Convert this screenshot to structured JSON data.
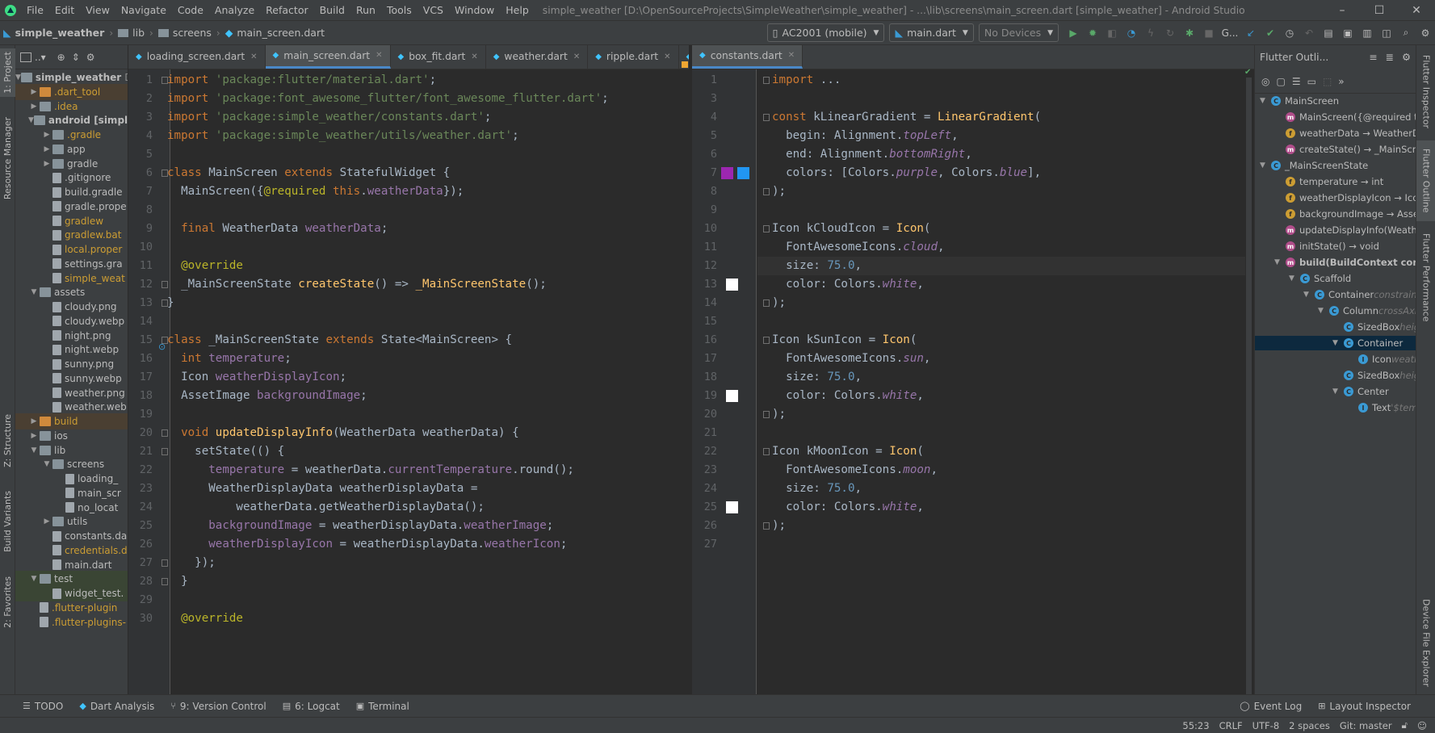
{
  "titlebar": {
    "menu": [
      "File",
      "Edit",
      "View",
      "Navigate",
      "Code",
      "Analyze",
      "Refactor",
      "Build",
      "Run",
      "Tools",
      "VCS",
      "Window",
      "Help"
    ],
    "window_title": "simple_weather [D:\\OpenSourceProjects\\SimpleWeather\\simple_weather] - ...\\lib\\screens\\main_screen.dart [simple_weather] - Android Studio"
  },
  "navbar": {
    "crumbs": [
      "simple_weather",
      "lib",
      "screens",
      "main_screen.dart"
    ],
    "device": "AC2001 (mobile)",
    "run_config": "main.dart",
    "devices2": "No Devices",
    "git_label": "G..."
  },
  "left_toolwindows": [
    "1: Project",
    "Resource Manager",
    "Z: Structure",
    "Build Variants",
    "2: Favorites"
  ],
  "right_toolwindows": [
    "Flutter Inspector",
    "Flutter Outline",
    "Flutter Performance",
    "Device File Explorer"
  ],
  "project": {
    "header_icon": "▪..▾",
    "root": "simple_weather",
    "root_suffix": "D:",
    "items": [
      {
        "label": ".dart_tool",
        "indent": 1,
        "arrow": "▶",
        "type": "folder",
        "color": "yellow",
        "bg": "orange"
      },
      {
        "label": ".idea",
        "indent": 1,
        "arrow": "▶",
        "type": "folder",
        "color": "yellow"
      },
      {
        "label": "android [simple",
        "indent": 1,
        "arrow": "▼",
        "type": "folder",
        "bold": true
      },
      {
        "label": ".gradle",
        "indent": 2,
        "arrow": "▶",
        "type": "folder",
        "color": "yellow"
      },
      {
        "label": "app",
        "indent": 2,
        "arrow": "▶",
        "type": "folder"
      },
      {
        "label": "gradle",
        "indent": 2,
        "arrow": "▶",
        "type": "folder"
      },
      {
        "label": ".gitignore",
        "indent": 2,
        "type": "file"
      },
      {
        "label": "build.gradle",
        "indent": 2,
        "type": "file"
      },
      {
        "label": "gradle.prope",
        "indent": 2,
        "type": "file"
      },
      {
        "label": "gradlew",
        "indent": 2,
        "type": "file",
        "color": "yellow"
      },
      {
        "label": "gradlew.bat",
        "indent": 2,
        "type": "file",
        "color": "yellow"
      },
      {
        "label": "local.proper",
        "indent": 2,
        "type": "file",
        "color": "yellow"
      },
      {
        "label": "settings.gra",
        "indent": 2,
        "type": "file"
      },
      {
        "label": "simple_weat",
        "indent": 2,
        "type": "file",
        "color": "yellow"
      },
      {
        "label": "assets",
        "indent": 1,
        "arrow": "▼",
        "type": "folder"
      },
      {
        "label": "cloudy.png",
        "indent": 2,
        "type": "file"
      },
      {
        "label": "cloudy.webp",
        "indent": 2,
        "type": "file"
      },
      {
        "label": "night.png",
        "indent": 2,
        "type": "file"
      },
      {
        "label": "night.webp",
        "indent": 2,
        "type": "file"
      },
      {
        "label": "sunny.png",
        "indent": 2,
        "type": "file"
      },
      {
        "label": "sunny.webp",
        "indent": 2,
        "type": "file"
      },
      {
        "label": "weather.png",
        "indent": 2,
        "type": "file"
      },
      {
        "label": "weather.web",
        "indent": 2,
        "type": "file"
      },
      {
        "label": "build",
        "indent": 1,
        "arrow": "▶",
        "type": "folder",
        "color": "yellow",
        "bg": "orange"
      },
      {
        "label": "ios",
        "indent": 1,
        "arrow": "▶",
        "type": "folder"
      },
      {
        "label": "lib",
        "indent": 1,
        "arrow": "▼",
        "type": "folder"
      },
      {
        "label": "screens",
        "indent": 2,
        "arrow": "▼",
        "type": "folder"
      },
      {
        "label": "loading_",
        "indent": 3,
        "type": "file"
      },
      {
        "label": "main_scr",
        "indent": 3,
        "type": "file"
      },
      {
        "label": "no_locat",
        "indent": 3,
        "type": "file"
      },
      {
        "label": "utils",
        "indent": 2,
        "arrow": "▶",
        "type": "folder"
      },
      {
        "label": "constants.da",
        "indent": 2,
        "type": "file"
      },
      {
        "label": "credentials.d",
        "indent": 2,
        "type": "file",
        "color": "yellow"
      },
      {
        "label": "main.dart",
        "indent": 2,
        "type": "file"
      },
      {
        "label": "test",
        "indent": 1,
        "arrow": "▼",
        "type": "folder",
        "bg": "green"
      },
      {
        "label": "widget_test.",
        "indent": 2,
        "type": "file",
        "bg": "green"
      },
      {
        "label": ".flutter-plugin",
        "indent": 1,
        "type": "file",
        "color": "yellow"
      },
      {
        "label": ".flutter-plugins-",
        "indent": 1,
        "type": "file",
        "color": "yellow"
      }
    ]
  },
  "editor1": {
    "tabs": [
      "loading_screen.dart",
      "main_screen.dart",
      "box_fit.dart",
      "weather.dart",
      "ripple.dart"
    ],
    "active_tab": 1,
    "overflow": "≡s",
    "lines": [
      [
        [
          "k",
          "import "
        ],
        [
          "s",
          "'package:flutter/material.dart'"
        ],
        [
          "pl",
          ";"
        ]
      ],
      [
        [
          "k",
          "import "
        ],
        [
          "s",
          "'package:font_awesome_flutter/font_awesome_flutter.dart'"
        ],
        [
          "pl",
          ";"
        ]
      ],
      [
        [
          "k",
          "import "
        ],
        [
          "s",
          "'package:simple_weather/constants.dart'"
        ],
        [
          "pl",
          ";"
        ]
      ],
      [
        [
          "k",
          "import "
        ],
        [
          "s",
          "'package:simple_weather/utils/weather.dart'"
        ],
        [
          "pl",
          ";"
        ]
      ],
      [],
      [
        [
          "k",
          "class "
        ],
        [
          "pl",
          "MainScreen "
        ],
        [
          "k",
          "extends "
        ],
        [
          "pl",
          "StatefulWidget {"
        ]
      ],
      [
        [
          "pl",
          "  MainScreen({"
        ],
        [
          "a",
          "@required "
        ],
        [
          "k",
          "this"
        ],
        [
          "pl",
          "."
        ],
        [
          "p",
          "weatherData"
        ],
        [
          "pl",
          "});"
        ]
      ],
      [],
      [
        [
          "k",
          "  final "
        ],
        [
          "pl",
          "WeatherData "
        ],
        [
          "p",
          "weatherData"
        ],
        [
          "pl",
          ";"
        ]
      ],
      [],
      [
        [
          "a",
          "  @override"
        ]
      ],
      [
        [
          "pl",
          "  _MainScreenState "
        ],
        [
          "f",
          "createState"
        ],
        [
          "pl",
          "() => "
        ],
        [
          "f",
          "_MainScreenState"
        ],
        [
          "pl",
          "();"
        ]
      ],
      [
        [
          "pl",
          "}"
        ]
      ],
      [],
      [
        [
          "k",
          "class "
        ],
        [
          "pl",
          "_MainScreenState "
        ],
        [
          "k",
          "extends "
        ],
        [
          "pl",
          "State<MainScreen> {"
        ]
      ],
      [
        [
          "k",
          "  int "
        ],
        [
          "p",
          "temperature"
        ],
        [
          "pl",
          ";"
        ]
      ],
      [
        [
          "pl",
          "  Icon "
        ],
        [
          "p",
          "weatherDisplayIcon"
        ],
        [
          "pl",
          ";"
        ]
      ],
      [
        [
          "pl",
          "  AssetImage "
        ],
        [
          "p",
          "backgroundImage"
        ],
        [
          "pl",
          ";"
        ]
      ],
      [],
      [
        [
          "k",
          "  void "
        ],
        [
          "f",
          "updateDisplayInfo"
        ],
        [
          "pl",
          "(WeatherData weatherData) {"
        ]
      ],
      [
        [
          "pl",
          "    setState(() {"
        ]
      ],
      [
        [
          "p",
          "      temperature"
        ],
        [
          "pl",
          " = weatherData."
        ],
        [
          "p",
          "currentTemperature"
        ],
        [
          "pl",
          ".round();"
        ]
      ],
      [
        [
          "pl",
          "      WeatherDisplayData weatherDisplayData ="
        ]
      ],
      [
        [
          "pl",
          "          weatherData.getWeatherDisplayData();"
        ]
      ],
      [
        [
          "p",
          "      backgroundImage"
        ],
        [
          "pl",
          " = weatherDisplayData."
        ],
        [
          "p",
          "weatherImage"
        ],
        [
          "pl",
          ";"
        ]
      ],
      [
        [
          "p",
          "      weatherDisplayIcon"
        ],
        [
          "pl",
          " = weatherDisplayData."
        ],
        [
          "p",
          "weatherIcon"
        ],
        [
          "pl",
          ";"
        ]
      ],
      [
        [
          "pl",
          "    });"
        ]
      ],
      [
        [
          "pl",
          "  }"
        ]
      ],
      [],
      [
        [
          "a",
          "  @override"
        ]
      ]
    ]
  },
  "editor2": {
    "tabs": [
      "constants.dart"
    ],
    "active_tab": 0,
    "line_numbers": [
      1,
      3,
      4,
      5,
      6,
      7,
      8,
      9,
      10,
      11,
      12,
      13,
      14,
      15,
      16,
      17,
      18,
      19,
      20,
      21,
      22,
      23,
      24,
      25,
      26,
      27
    ],
    "current_line": 12,
    "lines": [
      [
        [
          "k",
          "import "
        ],
        [
          "pl",
          "..."
        ]
      ],
      [],
      [
        [
          "k",
          "const "
        ],
        [
          "pl",
          "kLinearGradient = "
        ],
        [
          "f",
          "LinearGradient"
        ],
        [
          "pl",
          "("
        ]
      ],
      [
        [
          "pl",
          "  begin: Alignment."
        ],
        [
          "p i",
          "topLeft"
        ],
        [
          "pl",
          ","
        ]
      ],
      [
        [
          "pl",
          "  end: Alignment."
        ],
        [
          "p i",
          "bottomRight"
        ],
        [
          "pl",
          ","
        ]
      ],
      [
        [
          "pl",
          "  colors: [Colors."
        ],
        [
          "p i",
          "purple"
        ],
        [
          "pl",
          ", Colors."
        ],
        [
          "p i",
          "blue"
        ],
        [
          "pl",
          "],"
        ]
      ],
      [
        [
          "pl",
          ");"
        ]
      ],
      [],
      [
        [
          "pl",
          "Icon kCloudIcon = "
        ],
        [
          "f",
          "Icon"
        ],
        [
          "pl",
          "("
        ]
      ],
      [
        [
          "pl",
          "  FontAwesomeIcons."
        ],
        [
          "p i",
          "cloud"
        ],
        [
          "pl",
          ","
        ]
      ],
      [
        [
          "pl",
          "  size: "
        ],
        [
          "n",
          "75.0"
        ],
        [
          "pl",
          ","
        ]
      ],
      [
        [
          "pl",
          "  color: Colors."
        ],
        [
          "p i",
          "white"
        ],
        [
          "pl",
          ","
        ]
      ],
      [
        [
          "pl",
          ");"
        ]
      ],
      [],
      [
        [
          "pl",
          "Icon kSunIcon = "
        ],
        [
          "f",
          "Icon"
        ],
        [
          "pl",
          "("
        ]
      ],
      [
        [
          "pl",
          "  FontAwesomeIcons."
        ],
        [
          "p i",
          "sun"
        ],
        [
          "pl",
          ","
        ]
      ],
      [
        [
          "pl",
          "  size: "
        ],
        [
          "n",
          "75.0"
        ],
        [
          "pl",
          ","
        ]
      ],
      [
        [
          "pl",
          "  color: Colors."
        ],
        [
          "p i",
          "white"
        ],
        [
          "pl",
          ","
        ]
      ],
      [
        [
          "pl",
          ");"
        ]
      ],
      [],
      [
        [
          "pl",
          "Icon kMoonIcon = "
        ],
        [
          "f",
          "Icon"
        ],
        [
          "pl",
          "("
        ]
      ],
      [
        [
          "pl",
          "  FontAwesomeIcons."
        ],
        [
          "p i",
          "moon"
        ],
        [
          "pl",
          ","
        ]
      ],
      [
        [
          "pl",
          "  size: "
        ],
        [
          "n",
          "75.0"
        ],
        [
          "pl",
          ","
        ]
      ],
      [
        [
          "pl",
          "  color: Colors."
        ],
        [
          "p i",
          "white"
        ],
        [
          "pl",
          ","
        ]
      ],
      [
        [
          "pl",
          ");"
        ]
      ],
      []
    ]
  },
  "outline": {
    "title": "Flutter Outli...",
    "items": [
      {
        "indent": 0,
        "arrow": "▼",
        "icon": "c",
        "label": "MainScreen"
      },
      {
        "indent": 1,
        "icon": "m",
        "label": "MainScreen({@required this"
      },
      {
        "indent": 1,
        "icon": "f",
        "label": "weatherData → WeatherData"
      },
      {
        "indent": 1,
        "icon": "m",
        "label": "createState() → _MainScreenSt"
      },
      {
        "indent": 0,
        "arrow": "▼",
        "icon": "c",
        "label": "_MainScreenState"
      },
      {
        "indent": 1,
        "icon": "f",
        "label": "temperature → int"
      },
      {
        "indent": 1,
        "icon": "f",
        "label": "weatherDisplayIcon → Icon"
      },
      {
        "indent": 1,
        "icon": "f",
        "label": "backgroundImage → AssetIm"
      },
      {
        "indent": 1,
        "icon": "m",
        "label": "updateDisplayInfo(WeatherD"
      },
      {
        "indent": 1,
        "icon": "m",
        "label": "initState() → void"
      },
      {
        "indent": 1,
        "arrow": "▼",
        "icon": "m",
        "label": "build(BuildContext contex",
        "bold": true
      },
      {
        "indent": 2,
        "arrow": "▼",
        "icon": "c",
        "label": "Scaffold"
      },
      {
        "indent": 3,
        "arrow": "▼",
        "icon": "c",
        "label": "Container",
        "dim": " constraints"
      },
      {
        "indent": 4,
        "arrow": "▼",
        "icon": "c",
        "label": "Column",
        "dim": " crossAxis"
      },
      {
        "indent": 5,
        "icon": "c",
        "label": "SizedBox",
        "dim": " heig"
      },
      {
        "indent": 5,
        "arrow": "▼",
        "icon": "c",
        "label": "Container",
        "selected": true
      },
      {
        "indent": 6,
        "icon": "i",
        "label": "Icon",
        "dim": " weath"
      },
      {
        "indent": 5,
        "icon": "c",
        "label": "SizedBox",
        "dim": " heig"
      },
      {
        "indent": 5,
        "arrow": "▼",
        "icon": "c",
        "label": "Center"
      },
      {
        "indent": 6,
        "icon": "i",
        "label": "Text",
        "dim": " '$tem"
      }
    ]
  },
  "bottom_tabs": [
    "TODO",
    "Dart Analysis",
    "9: Version Control",
    "6: Logcat",
    "Terminal"
  ],
  "bottom_right_tabs": [
    "Event Log",
    "Layout Inspector"
  ],
  "status": {
    "position": "55:23",
    "line_sep": "CRLF",
    "encoding": "UTF-8",
    "indent": "2 spaces",
    "git": "Git: master"
  },
  "colors": {
    "swatch_purple": "#9c27b0",
    "swatch_blue": "#2196f3",
    "swatch_white": "#ffffff"
  }
}
